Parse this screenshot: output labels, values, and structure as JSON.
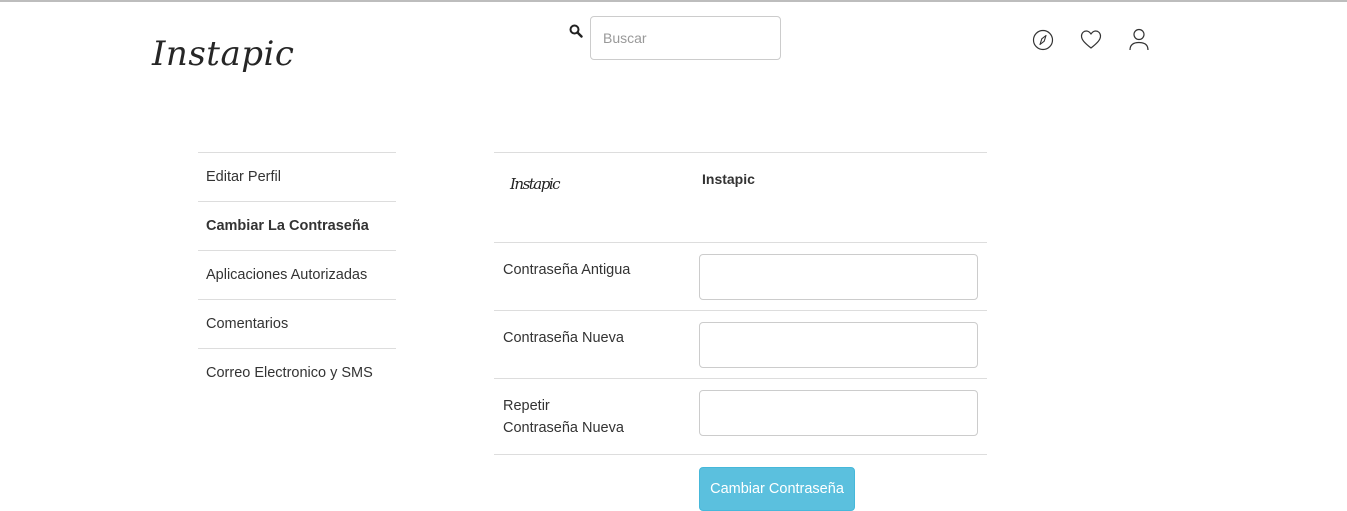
{
  "header": {
    "logo_text": "Instapic",
    "search": {
      "placeholder": "Buscar",
      "value": ""
    },
    "icons": [
      "compass-icon",
      "heart-icon",
      "user-icon"
    ]
  },
  "sidebar": {
    "items": [
      {
        "label": "Editar Perfil",
        "active": false
      },
      {
        "label": "Cambiar La Contraseña",
        "active": true
      },
      {
        "label": "Aplicaciones Autorizadas",
        "active": false
      },
      {
        "label": "Comentarios",
        "active": false
      },
      {
        "label": "Correo Electronico y SMS",
        "active": false
      }
    ]
  },
  "panel": {
    "small_logo_text": "Instapic",
    "brand_name": "Instapic",
    "fields": [
      {
        "label": "Contraseña Antigua",
        "value": ""
      },
      {
        "label": "Contraseña Nueva",
        "value": ""
      },
      {
        "label_line1": "Repetir",
        "label_line2": "Contraseña Nueva",
        "value": ""
      }
    ],
    "submit_label": "Cambiar Contraseña"
  },
  "colors": {
    "accent": "#5bc0de",
    "divider": "#dddddd",
    "text": "#333333"
  }
}
